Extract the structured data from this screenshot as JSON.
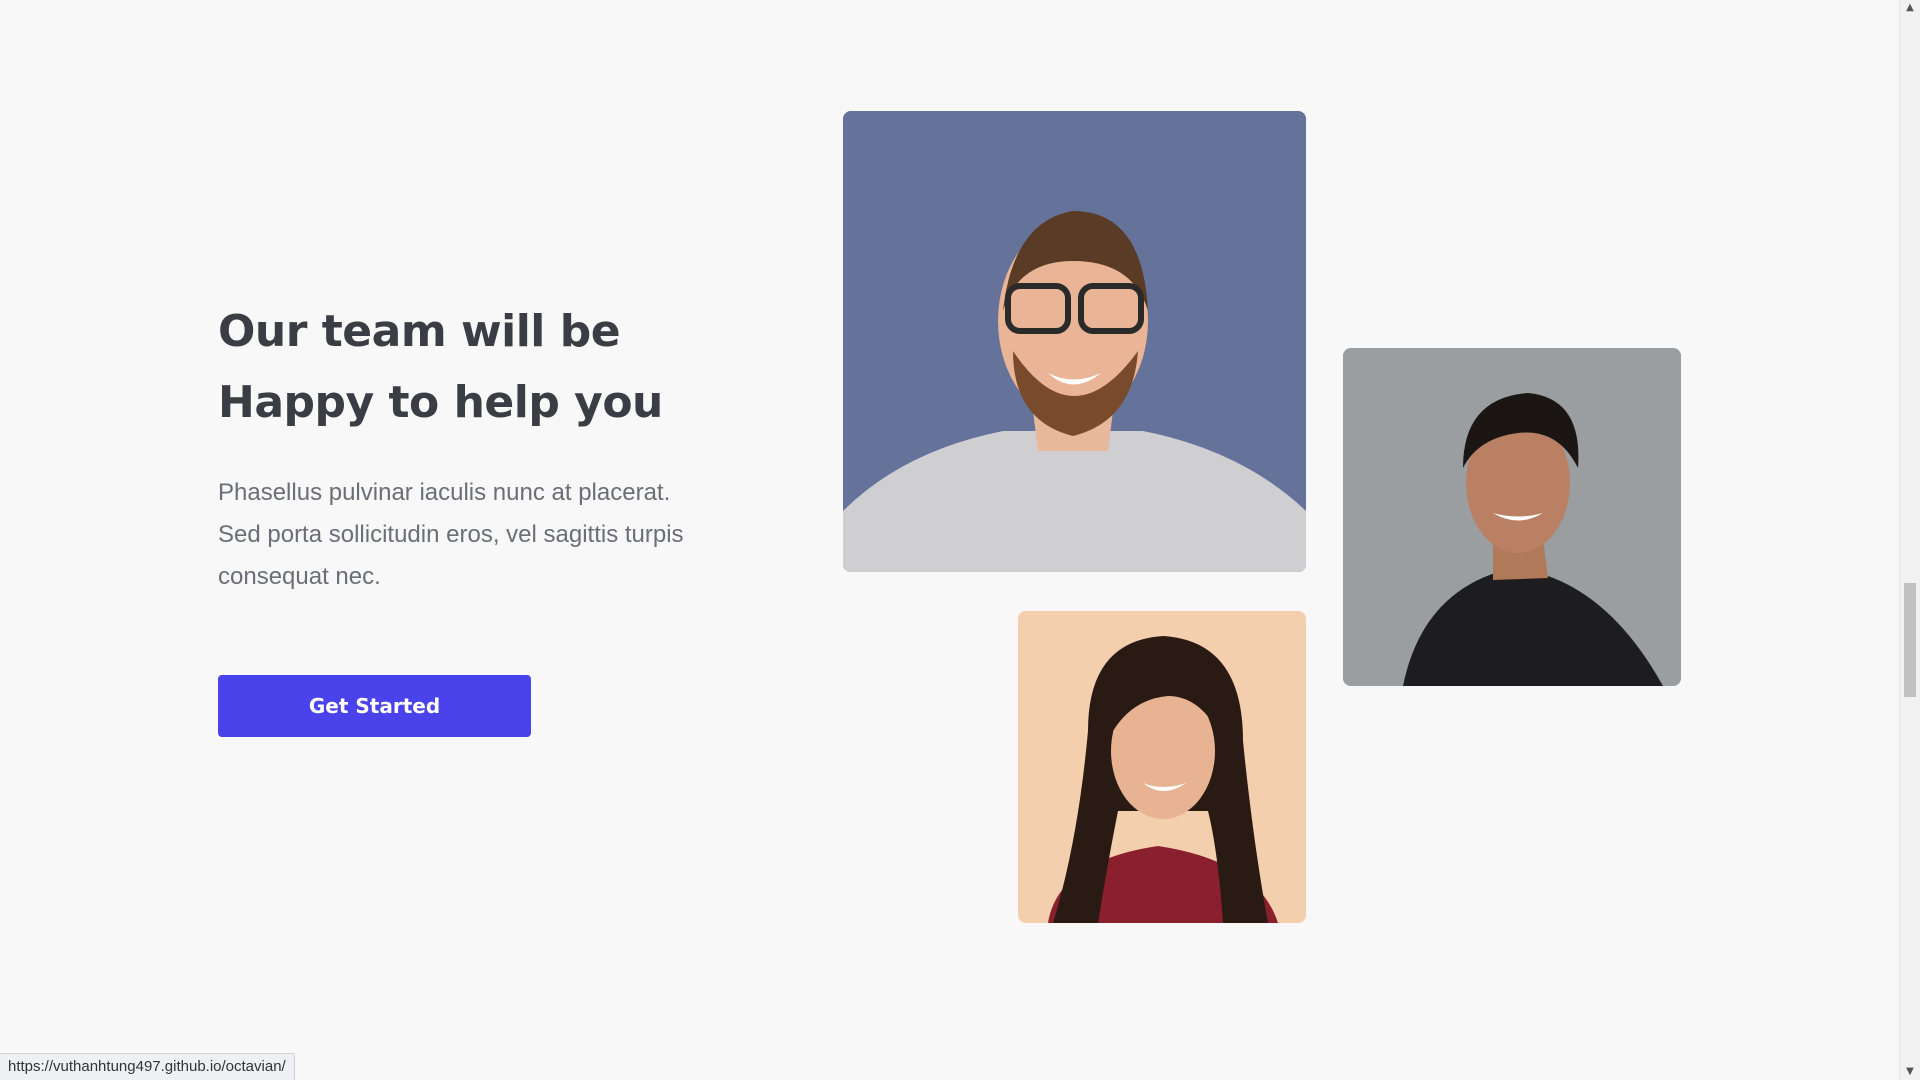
{
  "hero": {
    "heading_line1": "Our team will be",
    "heading_line2": "Happy to help you",
    "description": "Phasellus pulvinar iaculis nunc at placerat. Sed porta sollicitudin eros, vel sagittis turpis consequat nec.",
    "cta_label": "Get Started"
  },
  "team_photos": [
    {
      "subject": "bearded man with glasses",
      "background": "#627096"
    },
    {
      "subject": "smiling man in black shirt",
      "background": "#999c9f"
    },
    {
      "subject": "smiling woman with long hair",
      "background": "#f3cdaa"
    }
  ],
  "colors": {
    "accent": "#4a43ec",
    "heading": "#3b3d44",
    "body_text": "#6b6e76",
    "page_background": "#f8f8f8"
  },
  "status_bar": {
    "url": "https://vuthanhtung497.github.io/octavian/"
  }
}
